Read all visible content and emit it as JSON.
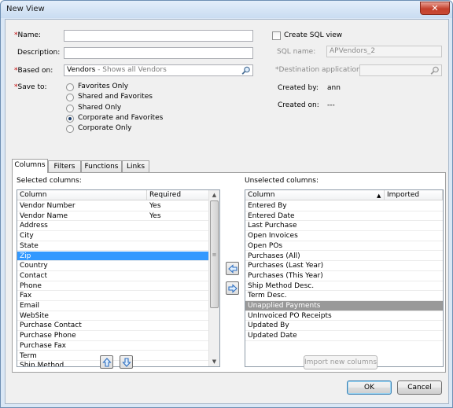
{
  "window": {
    "title": "New View",
    "close_glyph": "✕"
  },
  "form": {
    "name_label": "Name:",
    "name_value": "",
    "description_label": "Description:",
    "description_value": "",
    "based_on_label": "Based on:",
    "based_on_value": "Vendors",
    "based_on_hint": " - Shows all Vendors",
    "save_to_label": "Save to:",
    "save_to_options": [
      "Favorites Only",
      "Shared and Favorites",
      "Shared Only",
      "Corporate and Favorites",
      "Corporate Only"
    ],
    "save_to_selected": "Corporate and Favorites",
    "required_marker": "*"
  },
  "sql": {
    "create_sql_view_label": "Create SQL view",
    "create_sql_view_checked": false,
    "sql_name_label": "SQL name:",
    "sql_name_value": "APVendors_2",
    "destination_label": "Destination application:",
    "destination_value": "",
    "created_by_label": "Created by:",
    "created_by_value": "ann",
    "created_on_label": "Created on:",
    "created_on_value": "---"
  },
  "tabs": [
    "Columns",
    "Filters",
    "Functions",
    "Links"
  ],
  "active_tab": "Columns",
  "selected_columns": {
    "label": "Selected columns:",
    "headers": [
      "Column",
      "Required"
    ],
    "rows": [
      [
        "Vendor Number",
        "Yes"
      ],
      [
        "Vendor Name",
        "Yes"
      ],
      [
        "Address",
        ""
      ],
      [
        "City",
        ""
      ],
      [
        "State",
        ""
      ],
      [
        "Zip",
        ""
      ],
      [
        "Country",
        ""
      ],
      [
        "Contact",
        ""
      ],
      [
        "Phone",
        ""
      ],
      [
        "Fax",
        ""
      ],
      [
        "Email",
        ""
      ],
      [
        "WebSite",
        ""
      ],
      [
        "Purchase Contact",
        ""
      ],
      [
        "Purchase Phone",
        ""
      ],
      [
        "Purchase Fax",
        ""
      ],
      [
        "Term",
        ""
      ],
      [
        "Ship Method",
        ""
      ]
    ],
    "selected_row": "Zip"
  },
  "unselected_columns": {
    "label": "Unselected columns:",
    "headers": [
      "Column",
      "Imported"
    ],
    "rows": [
      "Entered By",
      "Entered Date",
      "Last Purchase",
      "Open Invoices",
      "Open POs",
      "Purchases (All)",
      "Purchases (Last Year)",
      "Purchases (This Year)",
      "Ship Method Desc.",
      "Term Desc.",
      "Unapplied Payments",
      "UnInvoiced PO Receipts",
      "Updated By",
      "Updated Date"
    ],
    "selected_row": "Unapplied Payments"
  },
  "buttons": {
    "import_new_columns": "Import new columns",
    "ok": "OK",
    "cancel": "Cancel"
  },
  "colors": {
    "selection_active": "#3399ff",
    "selection_inactive": "#999999",
    "required_marker": "#c00000",
    "arrow_blue": "#2f6fc0"
  },
  "icons": {
    "lookup": "magnifier-icon",
    "move_up": "arrow-up-icon",
    "move_down": "arrow-down-icon",
    "add_column": "arrow-left-icon",
    "remove_column": "arrow-right-icon",
    "close": "close-icon"
  }
}
